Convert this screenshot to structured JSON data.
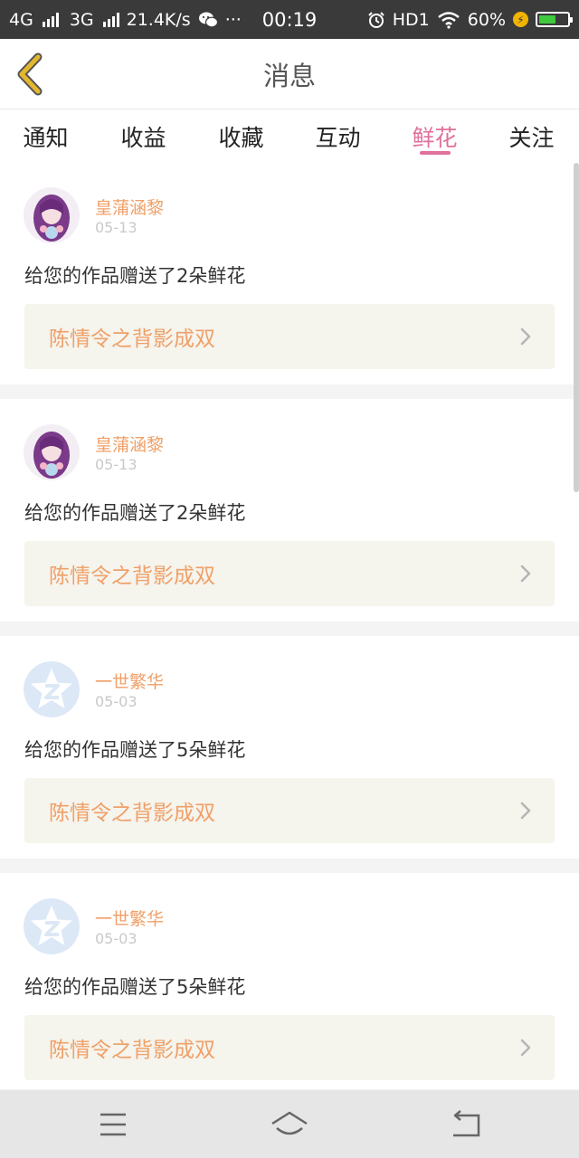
{
  "status_bar": {
    "network1": "4G",
    "network2": "3G",
    "speed": "21.4K/s",
    "more": "···",
    "time": "00:19",
    "hd": "HD1",
    "battery_percent": "60%",
    "battery_level": 0.6
  },
  "header": {
    "title": "消息"
  },
  "tabs": [
    {
      "label": "通知"
    },
    {
      "label": "收益"
    },
    {
      "label": "收藏"
    },
    {
      "label": "互动"
    },
    {
      "label": "鲜花"
    },
    {
      "label": "关注"
    }
  ],
  "active_tab": "鲜花",
  "messages": [
    {
      "user": "皇蒲涵黎",
      "date": "05-13",
      "text": "给您的作品赠送了2朵鲜花",
      "work": "陈情令之背影成双",
      "avatar": "girl-avatar-icon"
    },
    {
      "user": "皇蒲涵黎",
      "date": "05-13",
      "text": "给您的作品赠送了2朵鲜花",
      "work": "陈情令之背影成双",
      "avatar": "girl-avatar-icon"
    },
    {
      "user": "一世繁华",
      "date": "05-03",
      "text": "给您的作品赠送了5朵鲜花",
      "work": "陈情令之背影成双",
      "avatar": "qq-star-avatar-icon"
    },
    {
      "user": "一世繁华",
      "date": "05-03",
      "text": "给您的作品赠送了5朵鲜花",
      "work": "陈情令之背影成双",
      "avatar": "qq-star-avatar-icon"
    }
  ],
  "colors": {
    "accent": "#e0709c",
    "name_orange": "#f0a068",
    "status_bar": "#3a3a3a",
    "work_bg": "#f5f4ed",
    "back_arrow": "#e3b72e"
  },
  "nav_icons": [
    "menu-icon",
    "home-icon",
    "back-icon"
  ]
}
